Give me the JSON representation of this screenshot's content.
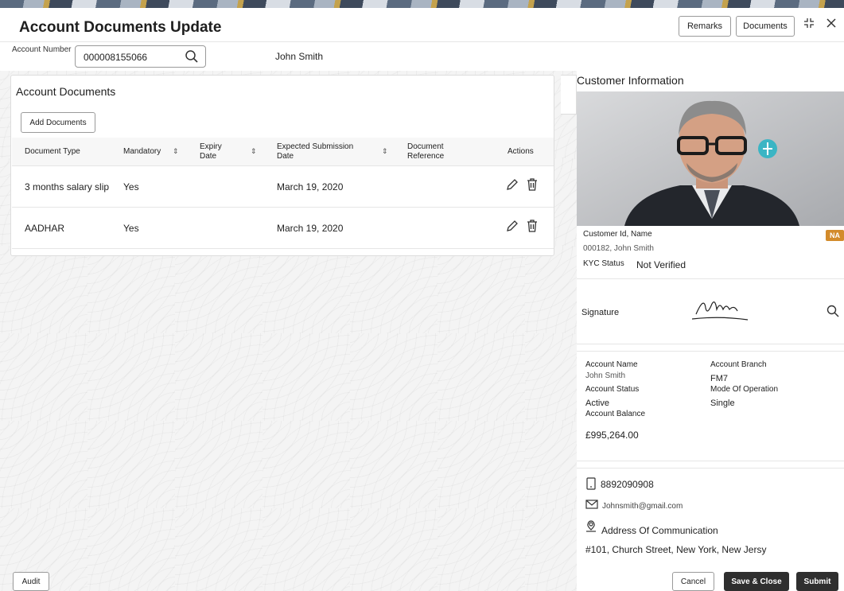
{
  "header": {
    "title": "Account Documents Update",
    "remarks_label": "Remarks",
    "documents_label": "Documents"
  },
  "account": {
    "number_label": "Account Number",
    "number_value": "000008155066",
    "customer_name": "John Smith"
  },
  "documents_card": {
    "title": "Account Documents",
    "add_label": "Add Documents",
    "columns": [
      "Document Type",
      "Mandatory",
      "Expiry Date",
      "Expected Submission Date",
      "Document Reference",
      "Actions"
    ],
    "rows": [
      {
        "type": "3 months salary slip",
        "mandatory": "Yes",
        "expiry": "",
        "expected": "March 19, 2020",
        "reference": ""
      },
      {
        "type": "AADHAR",
        "mandatory": "Yes",
        "expiry": "",
        "expected": "March 19, 2020",
        "reference": ""
      }
    ]
  },
  "customer_info": {
    "title": "Customer Information",
    "badge": "NA",
    "id_name_label": "Customer Id, Name",
    "id_name_value": "000182, John Smith",
    "kyc_label": "KYC Status",
    "kyc_value": "Not Verified",
    "signature_label": "Signature",
    "account_name_label": "Account Name",
    "account_name_value": "John Smith",
    "account_branch_label": "Account Branch",
    "account_branch_value": "FM7",
    "account_status_label": "Account Status",
    "account_status_value": "Active",
    "mode_label": "Mode Of Operation",
    "mode_value": "Single",
    "balance_label": "Account Balance",
    "balance_value": "£995,264.00",
    "phone": "8892090908",
    "email": "Johnsmith@gmail.com",
    "address_label": "Address Of Communication",
    "address_value": "#101, Church Street, New York, New Jersy"
  },
  "footer": {
    "audit_label": "Audit",
    "cancel_label": "Cancel",
    "save_close_label": "Save & Close",
    "submit_label": "Submit"
  },
  "colors": {
    "primary_button": "#2f2f2f",
    "badge": "#d38b2b",
    "accent_icon": "#3bb5c4"
  }
}
